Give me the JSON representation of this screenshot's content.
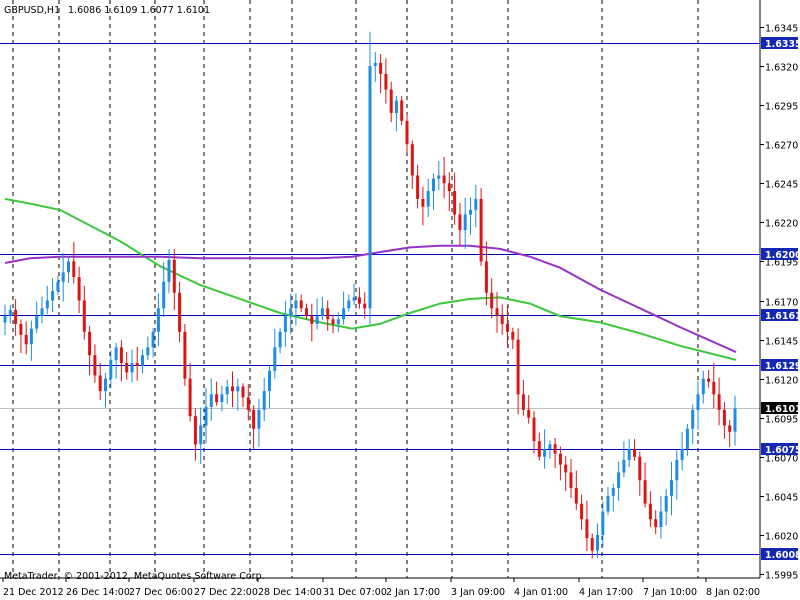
{
  "header": {
    "symbol": "GBPUSD,H1",
    "ohlc": "1.6086 1.6109 1.6077 1.6101"
  },
  "footer": {
    "copyright": "MetaTrader, © 2001-2012, MetaQuotes Software Corp."
  },
  "colors": {
    "bull": "#1E8CE6",
    "bear": "#DC1414",
    "ma_fast": "#3CC83C",
    "ma_slow": "#9632C8",
    "level_line": "#0000C8",
    "current_line": "#C0C0C0",
    "label_bg": "#1428B4",
    "current_label_bg": "#000000"
  },
  "chart_data": {
    "type": "candlestick",
    "symbol": "GBPUSD",
    "timeframe": "H1",
    "ylim": [
      1.5991,
      1.6352
    ],
    "y_ticks": [
      "1.6345",
      "1.6320",
      "1.6295",
      "1.6270",
      "1.6245",
      "1.6220",
      "1.6195",
      "1.6170",
      "1.6145",
      "1.6120",
      "1.6095",
      "1.6070",
      "1.6045",
      "1.6020",
      "1.5995"
    ],
    "x_tick_labels": [
      "21 Dec 2012",
      "26 Dec 14:00",
      "27 Dec 06:00",
      "27 Dec 22:00",
      "28 Dec 14:00",
      "31 Dec 07:00",
      "2 Jan 17:00",
      "3 Jan 09:00",
      "4 Jan 01:00",
      "4 Jan 17:00",
      "7 Jan 10:00",
      "8 Jan 02:00"
    ],
    "day_separators": [
      13,
      59,
      110,
      155,
      204,
      250,
      292,
      356,
      407,
      452,
      508,
      602,
      698
    ],
    "grid": "vertical-dashed",
    "horizontal_levels": [
      "1.6335",
      "1.6200",
      "1.6161",
      "1.6129",
      "1.6075",
      "1.6008"
    ],
    "current_price": "1.6101",
    "last_bar": {
      "open": 1.6086,
      "high": 1.6109,
      "low": 1.6077,
      "close": 1.6101
    },
    "closes": [
      1.616,
      1.6164,
      1.6155,
      1.6148,
      1.6142,
      1.6152,
      1.616,
      1.6165,
      1.617,
      1.6176,
      1.6182,
      1.6188,
      1.6195,
      1.6185,
      1.617,
      1.615,
      1.6135,
      1.6122,
      1.6112,
      1.612,
      1.6132,
      1.614,
      1.613,
      1.6124,
      1.613,
      1.6128,
      1.6135,
      1.614,
      1.615,
      1.6165,
      1.6182,
      1.6196,
      1.6175,
      1.615,
      1.612,
      1.6096,
      1.6078,
      1.609,
      1.6102,
      1.611,
      1.6105,
      1.611,
      1.6115,
      1.6112,
      1.6115,
      1.6108,
      1.61,
      1.6088,
      1.61,
      1.6112,
      1.6125,
      1.614,
      1.615,
      1.616,
      1.6165,
      1.617,
      1.6165,
      1.616,
      1.6155,
      1.616,
      1.6165,
      1.6158,
      1.6155,
      1.6158,
      1.6165,
      1.617,
      1.6172,
      1.6168,
      1.6165,
      1.632,
      1.6322,
      1.6315,
      1.6305,
      1.629,
      1.6298,
      1.6285,
      1.627,
      1.625,
      1.6235,
      1.623,
      1.624,
      1.6248,
      1.625,
      1.6245,
      1.624,
      1.6225,
      1.6215,
      1.6225,
      1.6228,
      1.6235,
      1.6195,
      1.6175,
      1.6165,
      1.616,
      1.6155,
      1.615,
      1.6145,
      1.611,
      1.61,
      1.6095,
      1.608,
      1.607,
      1.6075,
      1.6078,
      1.6072,
      1.6065,
      1.606,
      1.605,
      1.604,
      1.603,
      1.6018,
      1.601,
      1.602,
      1.6035,
      1.6045,
      1.605,
      1.606,
      1.6068,
      1.6075,
      1.607,
      1.6055,
      1.604,
      1.603,
      1.6025,
      1.6035,
      1.6045,
      1.6055,
      1.6068,
      1.6075,
      1.6088,
      1.61,
      1.611,
      1.612,
      1.6118,
      1.611,
      1.61,
      1.609,
      1.6086,
      1.6101
    ],
    "ma_fast": {
      "x": [
        5,
        30,
        60,
        90,
        120,
        160,
        200,
        240,
        280,
        320,
        352,
        380,
        410,
        440,
        470,
        500,
        530,
        560,
        600,
        640,
        680,
        736
      ],
      "y": [
        1.6235,
        1.6232,
        1.6228,
        1.6218,
        1.6208,
        1.6192,
        1.618,
        1.6171,
        1.6162,
        1.6156,
        1.6152,
        1.6155,
        1.6162,
        1.6168,
        1.6171,
        1.6172,
        1.6168,
        1.616,
        1.6156,
        1.6149,
        1.6141,
        1.6132
      ]
    },
    "ma_slow": {
      "x": [
        5,
        30,
        60,
        90,
        120,
        160,
        200,
        240,
        280,
        320,
        352,
        380,
        410,
        440,
        470,
        500,
        530,
        560,
        600,
        640,
        680,
        736
      ],
      "y": [
        1.6194,
        1.6197,
        1.6198,
        1.6198,
        1.6198,
        1.6198,
        1.6197,
        1.6197,
        1.6197,
        1.6197,
        1.6198,
        1.6201,
        1.6204,
        1.6205,
        1.6205,
        1.6203,
        1.6198,
        1.6191,
        1.6177,
        1.6165,
        1.6153,
        1.6137
      ]
    }
  }
}
